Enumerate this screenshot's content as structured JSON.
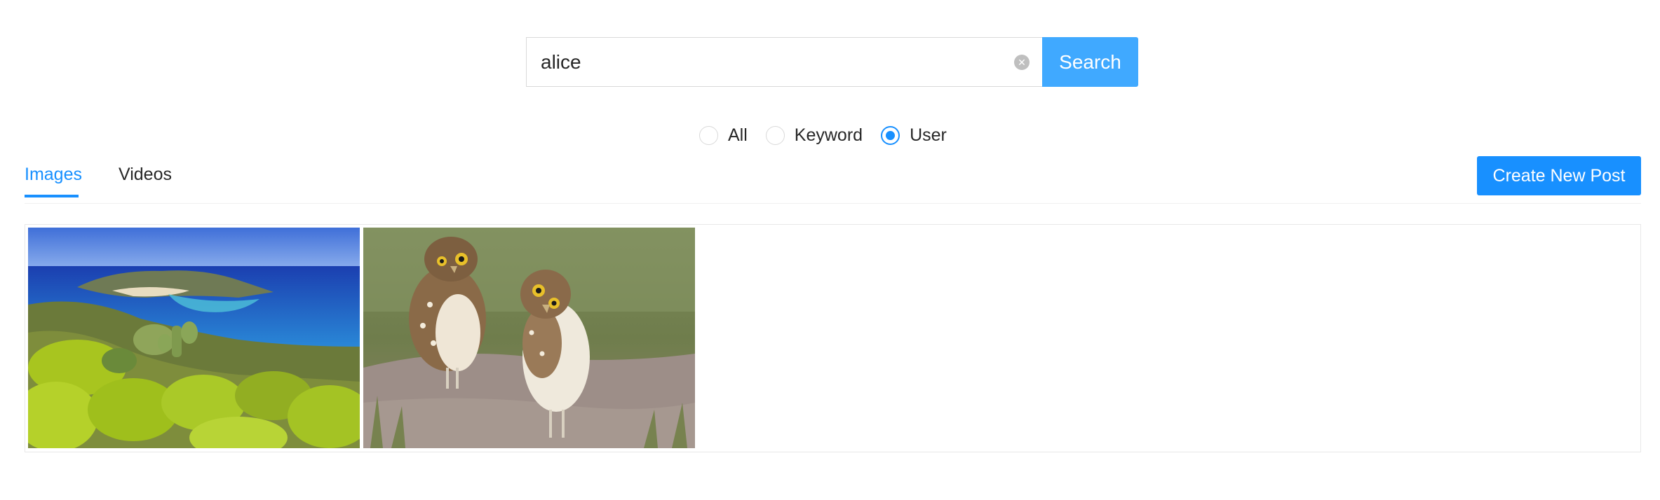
{
  "search": {
    "value": "alice",
    "button_label": "Search"
  },
  "filter": {
    "options": [
      {
        "label": "All",
        "checked": false
      },
      {
        "label": "Keyword",
        "checked": false
      },
      {
        "label": "User",
        "checked": true
      }
    ]
  },
  "tabs": [
    {
      "label": "Images",
      "active": true
    },
    {
      "label": "Videos",
      "active": false
    }
  ],
  "toolbar": {
    "create_label": "Create New Post"
  },
  "gallery": {
    "images": [
      {
        "subject": "coastal-landscape-image"
      },
      {
        "subject": "two-owls-image"
      }
    ]
  },
  "colors": {
    "primary": "#1890ff",
    "search_button": "#40a9ff",
    "border": "#d9d9d9"
  }
}
